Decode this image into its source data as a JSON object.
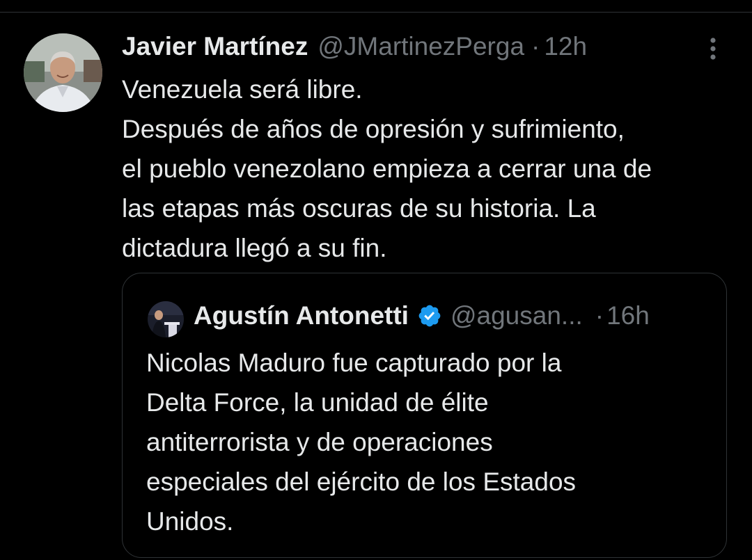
{
  "tweet": {
    "author_name": "Javier Martínez",
    "handle": "@JMartinezPerga",
    "separator": "·",
    "time": "12h",
    "more_icon": "more-vertical-icon",
    "lines": [
      "Venezuela será libre.",
      "Después de años de opresión y sufrimiento,",
      "el pueblo venezolano empieza a cerrar una de",
      "las etapas más oscuras de su historia. La",
      "dictadura llegó a su fin."
    ]
  },
  "quote": {
    "author_name": "Agustín Antonetti",
    "verified_icon": "verified-badge-icon",
    "handle": "@agusan...",
    "separator": "·",
    "time": "16h",
    "lines": [
      "Nicolas Maduro fue capturado por la",
      "Delta Force, la unidad de élite",
      "antiterrorista y de operaciones",
      "especiales del ejército de los Estados",
      "Unidos."
    ]
  },
  "colors": {
    "background": "#000000",
    "primary_text": "#e7e9ea",
    "secondary_text": "#71767b",
    "border": "#2f3336",
    "verified": "#1d9bf0"
  }
}
